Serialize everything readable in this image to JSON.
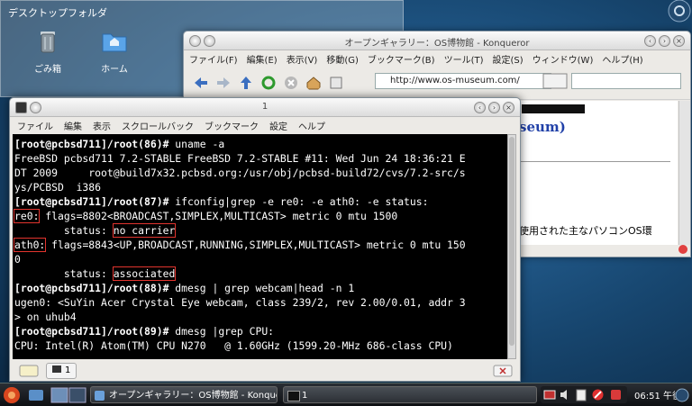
{
  "desktop": {
    "folderview_title": "デスクトップフォルダ",
    "icons": [
      {
        "label": "ごみ箱",
        "icon": "trash-icon"
      },
      {
        "label": "ホーム",
        "icon": "home-folder-icon"
      }
    ]
  },
  "konqueror": {
    "title": "オープンギャラリー：OS博物館 - Konqueror",
    "menu": [
      "ファイル(F)",
      "編集(E)",
      "表示(V)",
      "移動(G)",
      "ブックマーク(B)",
      "ツール(T)",
      "設定(S)",
      "ウィンドウ(W)",
      "ヘルプ(H)"
    ],
    "url": "http://www.os-museum.com/",
    "content_fragment_top": "seum)",
    "content_fragment_text": "使用された主なパソコンOS環"
  },
  "terminal": {
    "title": "1",
    "menu": [
      "ファイル",
      "編集",
      "表示",
      "スクロールバック",
      "ブックマーク",
      "設定",
      "ヘルプ"
    ],
    "lines": {
      "l1_prompt": "[root@pcbsd711]/root(86)#",
      "l1_cmd": " uname -a",
      "l2": "FreeBSD pcbsd711 7.2-STABLE FreeBSD 7.2-STABLE #11: Wed Jun 24 18:36:21 E",
      "l3": "DT 2009     root@build7x32.pcbsd.org:/usr/obj/pcbsd-build72/cvs/7.2-src/s",
      "l4": "ys/PCBSD  i386",
      "l5_prompt": "[root@pcbsd711]/root(87)#",
      "l5_cmd": " ifconfig|grep -e re0: -e ath0: -e status:",
      "l6_iface": "re0:",
      "l6_rest": " flags=8802<BROADCAST,SIMPLEX,MULTICAST> metric 0 mtu 1500",
      "l7_pre": "        status: ",
      "l7_val": "no carrier",
      "l8_iface": "ath0:",
      "l8_rest": " flags=8843<UP,BROADCAST,RUNNING,SIMPLEX,MULTICAST> metric 0 mtu 150",
      "l9": "0",
      "l10_pre": "        status: ",
      "l10_val": "associated",
      "l11_prompt": "[root@pcbsd711]/root(88)#",
      "l11_cmd": " dmesg | grep webcam|head -n 1",
      "l12": "ugen0: <SuYin Acer Crystal Eye webcam, class 239/2, rev 2.00/0.01, addr 3",
      "l13": "> on uhub4",
      "l14_prompt": "[root@pcbsd711]/root(89)#",
      "l14_cmd": " dmesg |grep CPU:",
      "l15": "CPU: Intel(R) Atom(TM) CPU N270   @ 1.60GHz (1599.20-MHz 686-class CPU)"
    },
    "tab_label": "1"
  },
  "taskbar": {
    "tasks": [
      "オープンギャラリー：OS博物館 - Konqueror",
      "1"
    ],
    "clock": "06:51 午後"
  }
}
